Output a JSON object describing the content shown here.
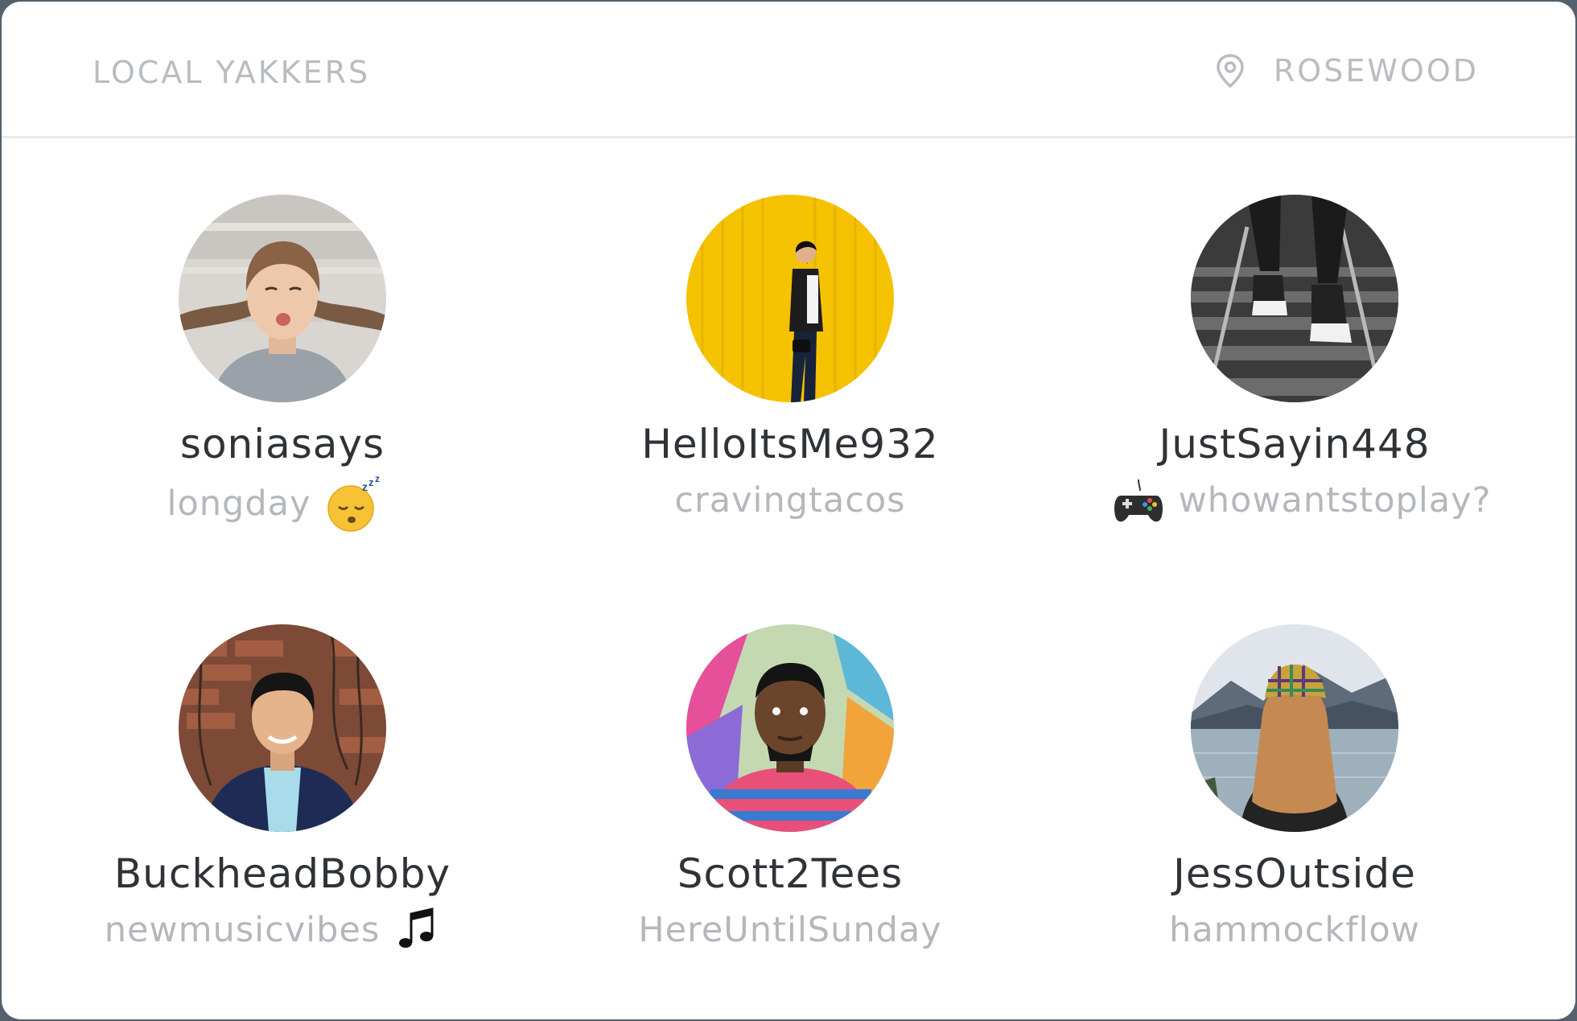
{
  "header": {
    "title": "LOCAL YAKKERS",
    "location": "ROSEWOOD"
  },
  "users": [
    {
      "name": "soniasays",
      "status": "longday",
      "emoji": "sleeping-face-icon",
      "emoji_side": "after"
    },
    {
      "name": "HelloItsMe932",
      "status": "cravingtacos",
      "emoji": null
    },
    {
      "name": "JustSayin448",
      "status": "whowantstoplay?",
      "emoji": "game-controller-icon",
      "emoji_side": "before"
    },
    {
      "name": "BuckheadBobby",
      "status": "newmusicvibes",
      "emoji": "music-notes-icon",
      "emoji_side": "after"
    },
    {
      "name": "Scott2Tees",
      "status": "HereUntilSunday",
      "emoji": null
    },
    {
      "name": "JessOutside",
      "status": "hammockflow",
      "emoji": null
    }
  ]
}
